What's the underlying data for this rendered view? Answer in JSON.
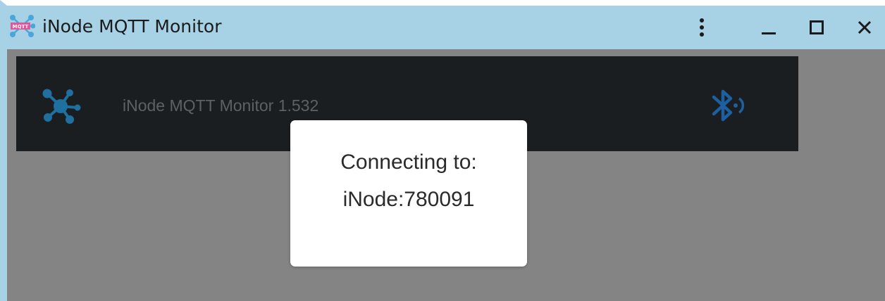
{
  "window": {
    "title": "iNode MQTT Monitor",
    "app_icon_label": "MQTT",
    "controls": {
      "menu_icon": "kebab-menu-icon",
      "minimize_icon": "minimize-icon",
      "maximize_icon": "maximize-icon",
      "close_icon": "close-icon"
    }
  },
  "header": {
    "app_name": "iNode MQTT Monitor 1.532",
    "logo_icon": "network-hub-icon",
    "status_icon": "bluetooth-searching-icon"
  },
  "dialog": {
    "line1": "Connecting to:",
    "line2": "iNode:780091"
  },
  "colors": {
    "titlebar": "#a7d2e5",
    "overlay": "#848484",
    "header_bg": "#1b1e20",
    "hub_blue": "#1f6fa0",
    "bluetooth_blue": "#1d5fa0",
    "dialog_bg": "#ffffff"
  }
}
